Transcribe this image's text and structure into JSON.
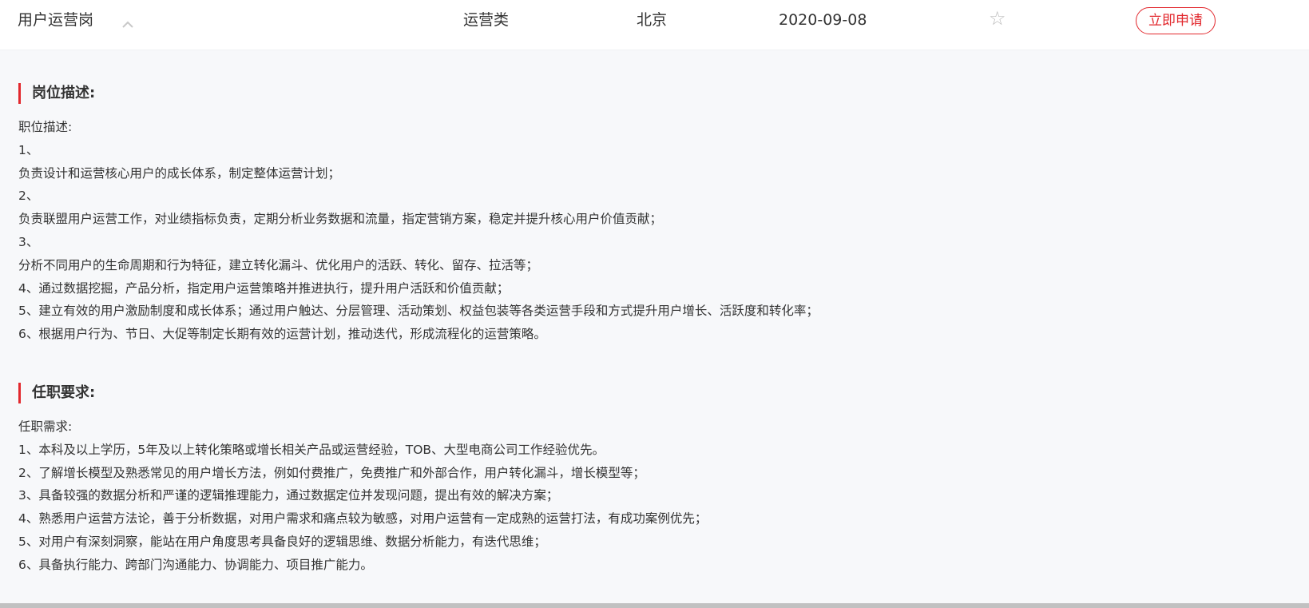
{
  "job": {
    "title": "用户运营岗",
    "category": "运营类",
    "city": "北京",
    "date": "2020-09-08",
    "apply_label": "立即申请",
    "star_icon": "☆"
  },
  "sections": [
    {
      "title": "岗位描述:",
      "lines": [
        "职位描述:",
        "1、",
        "负责设计和运营核心用户的成长体系，制定整体运营计划；",
        "2、",
        "负责联盟用户运营工作，对业绩指标负责，定期分析业务数据和流量，指定营销方案，稳定并提升核心用户价值贡献；",
        "3、",
        "分析不同用户的生命周期和行为特征，建立转化漏斗、优化用户的活跃、转化、留存、拉活等；",
        "4、通过数据挖掘，产品分析，指定用户运营策略并推进执行，提升用户活跃和价值贡献；",
        "5、建立有效的用户激励制度和成长体系；通过用户触达、分层管理、活动策划、权益包装等各类运营手段和方式提升用户增长、活跃度和转化率；",
        "6、根据用户行为、节日、大促等制定长期有效的运营计划，推动迭代，形成流程化的运营策略。"
      ]
    },
    {
      "title": "任职要求:",
      "lines": [
        "任职需求:",
        "1、本科及以上学历，5年及以上转化策略或增长相关产品或运营经验，TOB、大型电商公司工作经验优先。",
        "2、了解增长模型及熟悉常见的用户增长方法，例如付费推广，免费推广和外部合作，用户转化漏斗，增长模型等；",
        "3、具备较强的数据分析和严谨的逻辑推理能力，通过数据定位并发现问题，提出有效的解决方案；",
        "4、熟悉用户运营方法论，善于分析数据，对用户需求和痛点较为敏感，对用户运营有一定成熟的运营打法，有成功案例优先；",
        "5、对用户有深刻洞察，能站在用户角度思考具备良好的逻辑思维、数据分析能力，有迭代思维；",
        "6、具备执行能力、跨部门沟通能力、协调能力、项目推广能力。"
      ]
    }
  ],
  "colors": {
    "accent": "#e2282d",
    "background": "#f7f8fa",
    "text": "#333333"
  }
}
